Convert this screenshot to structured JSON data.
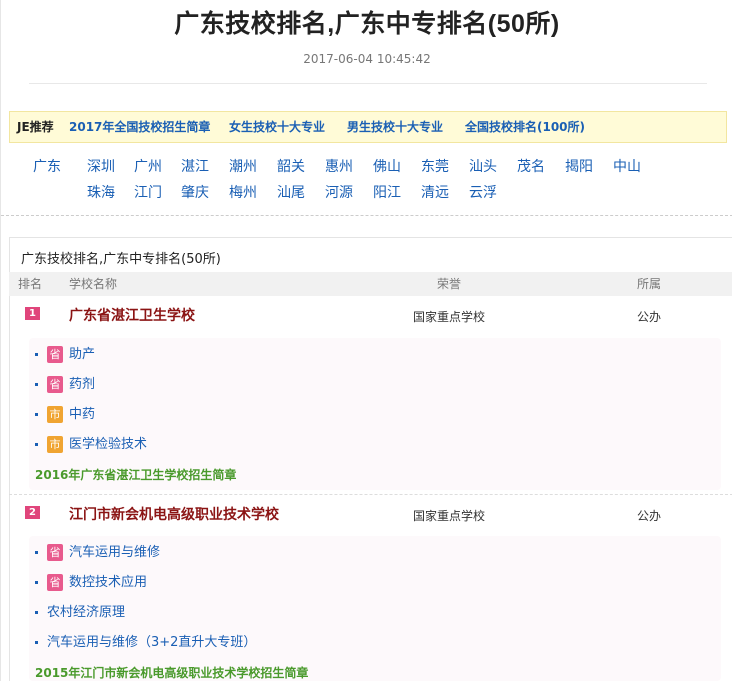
{
  "page": {
    "title": "广东技校排名,广东中专排名(50所)",
    "date": "2017-06-04 10:45:42"
  },
  "recommend": {
    "label": "JE推荐",
    "links": [
      "2017年全国技校招生简章",
      "女生技校十大专业",
      "男生技校十大专业",
      "全国技校排名(100所)"
    ]
  },
  "cities": {
    "province": "广东",
    "row1": [
      "深圳",
      "广州",
      "湛江",
      "潮州",
      "韶关",
      "惠州",
      "佛山",
      "东莞",
      "汕头",
      "茂名",
      "揭阳",
      "中山"
    ],
    "row2": [
      "珠海",
      "江门",
      "肇庆",
      "梅州",
      "汕尾",
      "河源",
      "阳江",
      "清远",
      "云浮"
    ]
  },
  "ranking": {
    "section_title": "广东技校排名,广东中专排名(50所)",
    "headers": {
      "rank": "排名",
      "name": "学校名称",
      "honor": "荣誉",
      "owner": "所属"
    },
    "schools": [
      {
        "rank": "1",
        "name": "广东省湛江卫生学校",
        "honor": "国家重点学校",
        "owner": "公办",
        "majors": [
          {
            "tag": "省",
            "name": "助产"
          },
          {
            "tag": "省",
            "name": "药剂"
          },
          {
            "tag": "市",
            "name": "中药"
          },
          {
            "tag": "市",
            "name": "医学检验技术"
          }
        ],
        "brochure": "2016年广东省湛江卫生学校招生简章"
      },
      {
        "rank": "2",
        "name": "江门市新会机电高级职业技术学校",
        "honor": "国家重点学校",
        "owner": "公办",
        "majors": [
          {
            "tag": "省",
            "name": "汽车运用与维修"
          },
          {
            "tag": "省",
            "name": "数控技术应用"
          },
          {
            "tag": "",
            "name": "农村经济原理"
          },
          {
            "tag": "",
            "name": "汽车运用与维修（3+2直升大专班）"
          }
        ],
        "brochure": "2015年江门市新会机电高级职业技术学校招生简章"
      }
    ]
  },
  "colors": {
    "link_blue": "#1a5fb4",
    "school_red": "#8b1414",
    "brochure_green": "#4a9a2c",
    "province_tag": "#e85a8d",
    "city_tag": "#f0a431",
    "rank_badge": "#e0457b",
    "recommend_bg": "#fffbd7"
  }
}
